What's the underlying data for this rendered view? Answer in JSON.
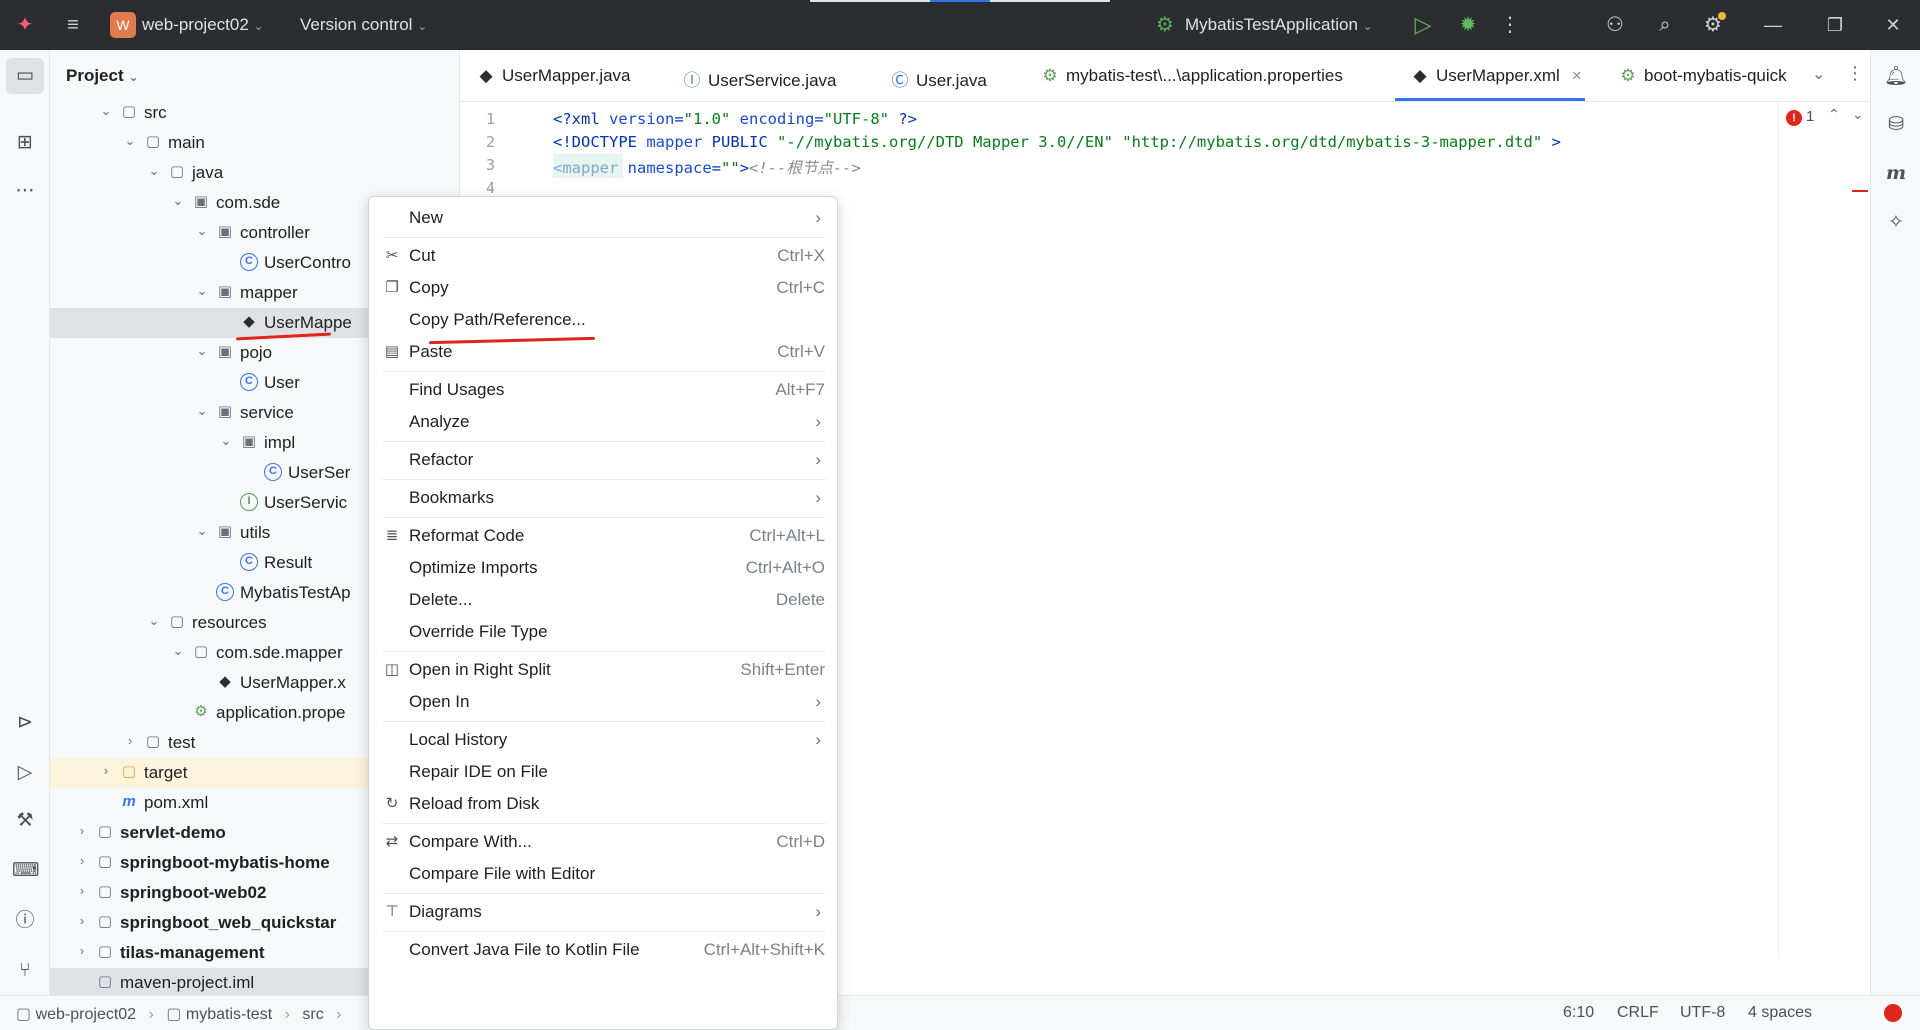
{
  "titlebar": {
    "project_badge": "W",
    "project_name": "web-project02",
    "version_control": "Version control",
    "run_config": "MybatisTestApplication"
  },
  "project_panel": {
    "title": "Project",
    "tree": [
      {
        "label": "src",
        "indent": 1,
        "chevron": "down",
        "icon": "folder"
      },
      {
        "label": "main",
        "indent": 2,
        "chevron": "down",
        "icon": "folder"
      },
      {
        "label": "java",
        "indent": 3,
        "chevron": "down",
        "icon": "folder"
      },
      {
        "label": "com.sde",
        "indent": 4,
        "chevron": "down",
        "icon": "package"
      },
      {
        "label": "controller",
        "indent": 5,
        "chevron": "down",
        "icon": "package"
      },
      {
        "label": "UserContro",
        "indent": 6,
        "chevron": "",
        "icon": "class"
      },
      {
        "label": "mapper",
        "indent": 5,
        "chevron": "down",
        "icon": "package"
      },
      {
        "label": "UserMappe",
        "indent": 6,
        "chevron": "",
        "icon": "xml"
      },
      {
        "label": "pojo",
        "indent": 5,
        "chevron": "down",
        "icon": "package"
      },
      {
        "label": "User",
        "indent": 6,
        "chevron": "",
        "icon": "class"
      },
      {
        "label": "service",
        "indent": 5,
        "chevron": "down",
        "icon": "package"
      },
      {
        "label": "impl",
        "indent": 6,
        "chevron": "down",
        "icon": "package"
      },
      {
        "label": "UserSer",
        "indent": 7,
        "chevron": "",
        "icon": "class"
      },
      {
        "label": "UserServic",
        "indent": 6,
        "chevron": "",
        "icon": "interface"
      },
      {
        "label": "utils",
        "indent": 5,
        "chevron": "down",
        "icon": "package"
      },
      {
        "label": "Result",
        "indent": 6,
        "chevron": "",
        "icon": "class"
      },
      {
        "label": "MybatisTestAp",
        "indent": 5,
        "chevron": "",
        "icon": "class"
      },
      {
        "label": "resources",
        "indent": 3,
        "chevron": "down",
        "icon": "folder"
      },
      {
        "label": "com.sde.mapper",
        "indent": 4,
        "chevron": "down",
        "icon": "folder"
      },
      {
        "label": "UserMapper.x",
        "indent": 5,
        "chevron": "",
        "icon": "xml"
      },
      {
        "label": "application.prope",
        "indent": 4,
        "chevron": "",
        "icon": "props"
      },
      {
        "label": "test",
        "indent": 2,
        "chevron": "right",
        "icon": "folder"
      },
      {
        "label": "target",
        "indent": 1,
        "chevron": "right",
        "icon": "folder-orange"
      },
      {
        "label": "pom.xml",
        "indent": 1,
        "chevron": "",
        "icon": "maven"
      },
      {
        "label": "servlet-demo",
        "indent": 0,
        "chevron": "right",
        "icon": "module"
      },
      {
        "label": "springboot-mybatis-home",
        "indent": 0,
        "chevron": "right",
        "icon": "module"
      },
      {
        "label": "springboot-web02",
        "indent": 0,
        "chevron": "right",
        "icon": "module"
      },
      {
        "label": "springboot_web_quickstar",
        "indent": 0,
        "chevron": "right",
        "icon": "module"
      },
      {
        "label": "tilas-management",
        "indent": 0,
        "chevron": "right",
        "icon": "module"
      },
      {
        "label": "maven-project.iml",
        "indent": 0,
        "chevron": "",
        "icon": "file"
      }
    ]
  },
  "tabs": [
    {
      "label": "UserMapper.java",
      "icon": "xml"
    },
    {
      "label": "UserService.java",
      "icon": "interface"
    },
    {
      "label": "User.java",
      "icon": "class"
    },
    {
      "label": "mybatis-test\\...\\application.properties",
      "icon": "props"
    },
    {
      "label": "UserMapper.xml",
      "icon": "xml",
      "active": true,
      "close": "×"
    },
    {
      "label": "boot-mybatis-quick",
      "icon": "props"
    }
  ],
  "editor": {
    "line_numbers": [
      "1",
      "2",
      "3",
      "4"
    ],
    "lines": [
      [
        {
          "t": "<?",
          "c": "tag"
        },
        {
          "t": "xml ",
          "c": "tag"
        },
        {
          "t": "version",
          "c": "attr"
        },
        {
          "t": "=",
          "c": "tag"
        },
        {
          "t": "\"1.0\" ",
          "c": "str"
        },
        {
          "t": "encoding",
          "c": "attr"
        },
        {
          "t": "=",
          "c": "tag"
        },
        {
          "t": "\"UTF-8\"",
          "c": "str"
        },
        {
          "t": " ?>",
          "c": "tag"
        }
      ],
      [
        {
          "t": "<!DOCTYPE ",
          "c": "tag"
        },
        {
          "t": "mapper ",
          "c": "attr"
        },
        {
          "t": "PUBLIC ",
          "c": "tag"
        },
        {
          "t": "\"-//mybatis.org//DTD Mapper 3.0//EN\" ",
          "c": "str"
        },
        {
          "t": "\"http://mybatis.org/dtd/mybatis-3-mapper.dtd\"",
          "c": "str"
        },
        {
          "t": " >",
          "c": "tag"
        }
      ],
      [
        {
          "t": "<mapper",
          "c": "tag"
        },
        {
          "t": " namespace",
          "c": "attr"
        },
        {
          "t": "=",
          "c": "tag"
        },
        {
          "t": "\"\"",
          "c": "str"
        },
        {
          "t": ">",
          "c": "tag"
        },
        {
          "t": "<!--根节点-->",
          "c": "cmt"
        }
      ]
    ],
    "problems_count": "1"
  },
  "context_menu": {
    "items": [
      {
        "label": "New",
        "shortcut": "",
        "arrow": true,
        "icon": ""
      },
      {
        "sep": true
      },
      {
        "label": "Cut",
        "shortcut": "Ctrl+X",
        "arrow": false,
        "icon": "scissors"
      },
      {
        "label": "Copy",
        "shortcut": "Ctrl+C",
        "arrow": false,
        "icon": "copy"
      },
      {
        "label": "Copy Path/Reference...",
        "shortcut": "",
        "arrow": false,
        "icon": ""
      },
      {
        "label": "Paste",
        "shortcut": "Ctrl+V",
        "arrow": false,
        "icon": "paste"
      },
      {
        "sep": true
      },
      {
        "label": "Find Usages",
        "shortcut": "Alt+F7",
        "arrow": false,
        "icon": ""
      },
      {
        "label": "Analyze",
        "shortcut": "",
        "arrow": true,
        "icon": ""
      },
      {
        "sep": true
      },
      {
        "label": "Refactor",
        "shortcut": "",
        "arrow": true,
        "icon": ""
      },
      {
        "sep": true
      },
      {
        "label": "Bookmarks",
        "shortcut": "",
        "arrow": true,
        "icon": ""
      },
      {
        "sep": true
      },
      {
        "label": "Reformat Code",
        "shortcut": "Ctrl+Alt+L",
        "arrow": false,
        "icon": "reformat"
      },
      {
        "label": "Optimize Imports",
        "shortcut": "Ctrl+Alt+O",
        "arrow": false,
        "icon": ""
      },
      {
        "label": "Delete...",
        "shortcut": "Delete",
        "arrow": false,
        "icon": ""
      },
      {
        "label": "Override File Type",
        "shortcut": "",
        "arrow": false,
        "icon": ""
      },
      {
        "sep": true
      },
      {
        "label": "Open in Right Split",
        "shortcut": "Shift+Enter",
        "arrow": false,
        "icon": "split"
      },
      {
        "label": "Open In",
        "shortcut": "",
        "arrow": true,
        "icon": ""
      },
      {
        "sep": true
      },
      {
        "label": "Local History",
        "shortcut": "",
        "arrow": true,
        "icon": ""
      },
      {
        "label": "Repair IDE on File",
        "shortcut": "",
        "arrow": false,
        "icon": ""
      },
      {
        "label": "Reload from Disk",
        "shortcut": "",
        "arrow": false,
        "icon": "reload"
      },
      {
        "sep": true
      },
      {
        "label": "Compare With...",
        "shortcut": "Ctrl+D",
        "arrow": false,
        "icon": "compare"
      },
      {
        "label": "Compare File with Editor",
        "shortcut": "",
        "arrow": false,
        "icon": ""
      },
      {
        "sep": true
      },
      {
        "label": "Diagrams",
        "shortcut": "",
        "arrow": true,
        "icon": "diagram"
      },
      {
        "sep": true
      },
      {
        "label": "Convert Java File to Kotlin File",
        "shortcut": "Ctrl+Alt+Shift+K",
        "arrow": false,
        "icon": ""
      }
    ]
  },
  "statusbar": {
    "breadcrumb": [
      "web-project02",
      "mybatis-test",
      "src"
    ],
    "position": "6:10",
    "line_sep": "CRLF",
    "encoding": "UTF-8",
    "indent": "4 spaces"
  },
  "colors": {
    "accent": "#3574f0",
    "annotation_red": "#e0251b",
    "titlebar_bg": "#2b2d30"
  }
}
